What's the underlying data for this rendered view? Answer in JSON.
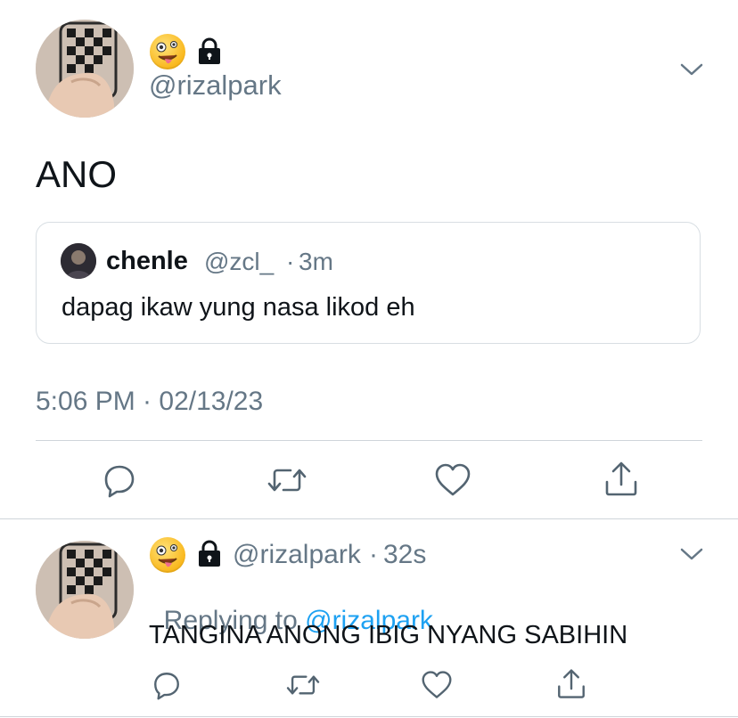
{
  "main_tweet": {
    "handle": "@rizalpark",
    "text": "ANO",
    "quote": {
      "name": "chenle",
      "handle": "@zcl_",
      "sep": "·",
      "time": "3m",
      "text": "dapag ikaw yung nasa likod eh"
    },
    "timestamp": "5:06 PM · 02/13/23"
  },
  "reply_tweet": {
    "handle": "@rizalpark",
    "sep": "·",
    "time": "32s",
    "replying_prefix": "Replying to ",
    "replying_to": "@rizalpark",
    "text": "TANGINA ANONG IBIG NYANG SABIHIN"
  },
  "icons": {
    "emoji": "zany-face",
    "lock": "lock-icon",
    "menu": "chevron-down-icon",
    "actions": [
      "reply-icon",
      "retweet-icon",
      "like-icon",
      "share-icon"
    ]
  },
  "colors": {
    "link": "#1da1f2",
    "muted": "#657786",
    "text": "#0f1419",
    "border": "#d8dee3"
  }
}
